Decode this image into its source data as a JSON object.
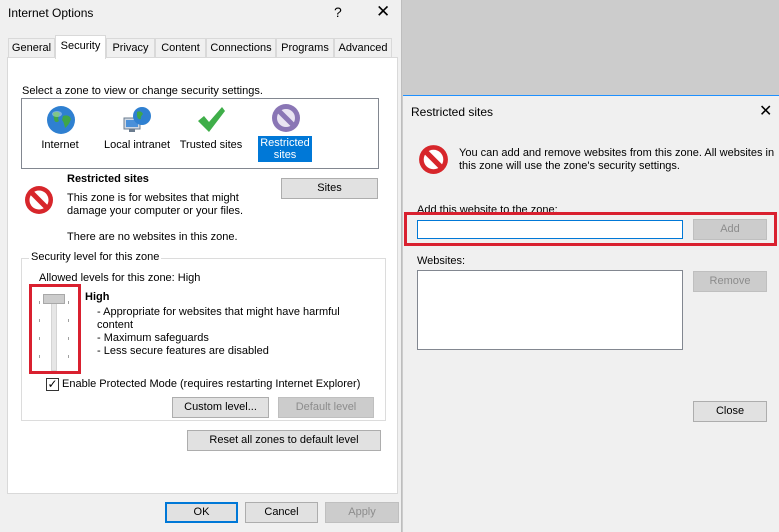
{
  "internet_options": {
    "title": "Internet Options",
    "help_glyph": "?",
    "close_glyph": "✕",
    "tabs": [
      {
        "label": "General"
      },
      {
        "label": "Security"
      },
      {
        "label": "Privacy"
      },
      {
        "label": "Content"
      },
      {
        "label": "Connections"
      },
      {
        "label": "Programs"
      },
      {
        "label": "Advanced"
      }
    ],
    "active_tab": "Security",
    "zone_prompt": "Select a zone to view or change security settings.",
    "zones": [
      {
        "label": "Internet",
        "icon": "globe-icon"
      },
      {
        "label": "Local intranet",
        "icon": "network-globe-icon"
      },
      {
        "label": "Trusted sites",
        "icon": "checkmark-icon"
      },
      {
        "label_line1": "Restricted",
        "label_line2": "sites",
        "icon": "restricted-icon"
      }
    ],
    "selected_zone": "Restricted sites",
    "zone_info": {
      "heading": "Restricted sites",
      "description_line1": "This zone is for websites that might",
      "description_line2": "damage your computer or your files.",
      "status": "There are no websites in this zone."
    },
    "sites_button": "Sites",
    "security_level": {
      "group_title": "Security level for this zone",
      "allowed_levels": "Allowed levels for this zone: High",
      "level": "High",
      "bullets": [
        "- Appropriate for websites that might have harmful",
        "content",
        "- Maximum safeguards",
        "- Less secure features are disabled"
      ]
    },
    "protected_mode": {
      "label": "Enable Protected Mode (requires restarting Internet Explorer)",
      "checked": true,
      "check_glyph": "✓"
    },
    "custom_level_button": "Custom level...",
    "default_level_button": "Default level",
    "reset_button": "Reset all zones to default level",
    "ok_button": "OK",
    "cancel_button": "Cancel",
    "apply_button": "Apply"
  },
  "restricted_sites": {
    "title": "Restricted sites",
    "close_glyph": "✕",
    "info_line1": "You can add and remove websites from this zone. All websites in",
    "info_line2": "this zone will use the zone's security settings.",
    "add_label": "Add this website to the zone:",
    "add_input_value": "",
    "add_button": "Add",
    "websites_label": "Websites:",
    "websites": [],
    "remove_button": "Remove",
    "close_button": "Close"
  },
  "colors": {
    "highlight_red": "#d9202f",
    "selection_blue": "#0078d7"
  }
}
